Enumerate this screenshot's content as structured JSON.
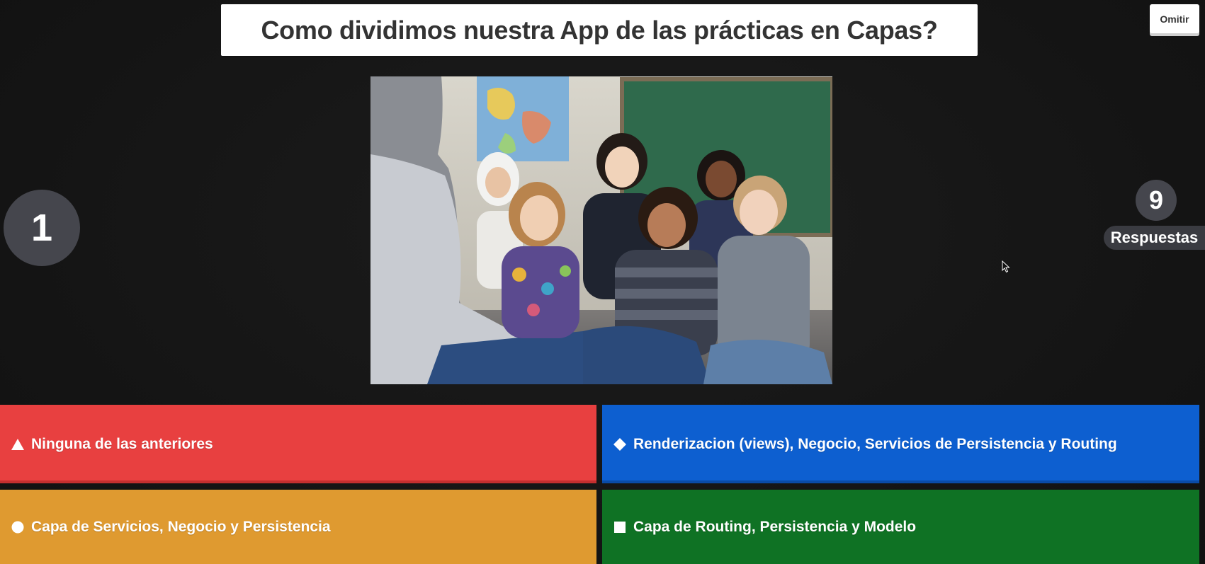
{
  "question": {
    "text": "Como dividimos nuestra App de las prácticas en Capas?"
  },
  "skip": {
    "label": "Omitir"
  },
  "timer": {
    "value": "1"
  },
  "answers_count": {
    "value": "9",
    "label": "Respuestas"
  },
  "image": {
    "icon": "classroom-children-photo"
  },
  "answers": [
    {
      "shape": "triangle-icon",
      "color": "#e84040",
      "label": "Ninguna de las anteriores"
    },
    {
      "shape": "diamond-icon",
      "color": "#0d5fd0",
      "label": "Renderizacion (views), Negocio, Servicios de Persistencia y Routing"
    },
    {
      "shape": "circle-icon",
      "color": "#df9a30",
      "label": "Capa de Servicios, Negocio y Persistencia"
    },
    {
      "shape": "square-icon",
      "color": "#0f7224",
      "label": "Capa de Routing, Persistencia y Modelo"
    }
  ]
}
